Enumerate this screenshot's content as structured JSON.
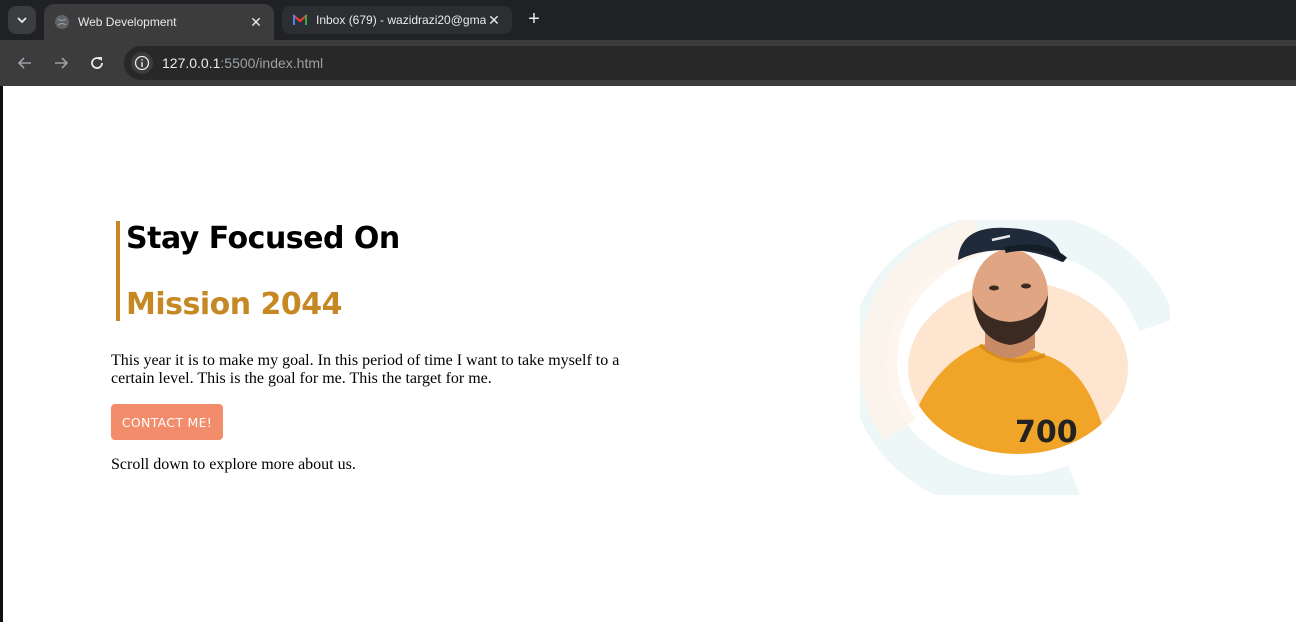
{
  "browser": {
    "tabs": [
      {
        "title": "Web Development",
        "active": true
      },
      {
        "title": "Inbox (679) - wazidrazi20@gma",
        "active": false
      }
    ],
    "url_host": "127.0.0.1",
    "url_rest": ":5500/index.html"
  },
  "hero": {
    "heading_line1": "Stay Focused On",
    "heading_line2": "Mission 2044",
    "intro": "This year it is to make my goal. In this period of time I want to take myself to a certain level. This is the goal for me. This the target for me.",
    "button_label": "CONTACT ME!",
    "scroll_text": "Scroll down to explore more about us."
  },
  "colors": {
    "accent": "#c58822",
    "button": "#f28c6b"
  },
  "icons": [
    "tab-search-icon",
    "globe-icon",
    "gmail-icon",
    "close-icon",
    "plus-icon",
    "back-icon",
    "forward-icon",
    "reload-icon",
    "info-icon"
  ]
}
